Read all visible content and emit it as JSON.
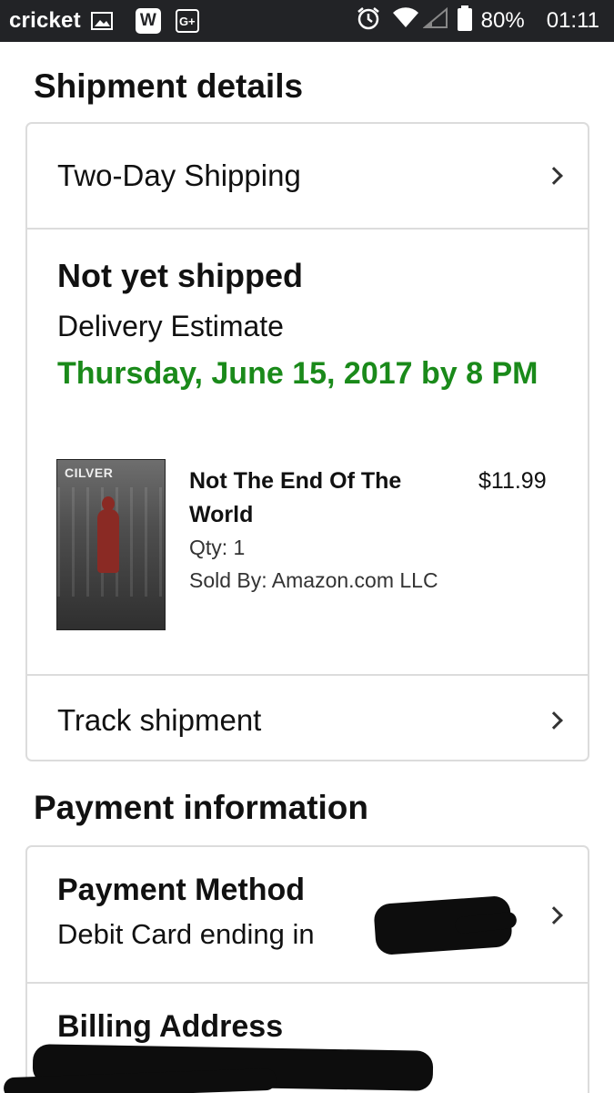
{
  "status_bar": {
    "carrier": "cricket",
    "notif_w": "W",
    "notif_g": "G+",
    "battery_percent": "80%",
    "time": "01:11",
    "icons": [
      "image-icon",
      "alarm-icon",
      "wifi-icon",
      "signal-icon",
      "battery-icon"
    ]
  },
  "shipment": {
    "heading": "Shipment details",
    "shipping_speed": "Two-Day Shipping",
    "status": "Not yet shipped",
    "estimate_label": "Delivery Estimate",
    "estimate_date": "Thursday, June 15, 2017 by 8 PM",
    "estimate_color": "#1a8a1a",
    "item": {
      "cover_text": "CILVER",
      "title": "Not The End Of The World",
      "price": "$11.99",
      "qty": "Qty: 1",
      "sold_by": "Sold By: Amazon.com LLC"
    },
    "track_label": "Track shipment"
  },
  "payment": {
    "heading": "Payment information",
    "method_title": "Payment Method",
    "method_detail": "Debit Card ending in",
    "billing_title": "Billing Address"
  }
}
